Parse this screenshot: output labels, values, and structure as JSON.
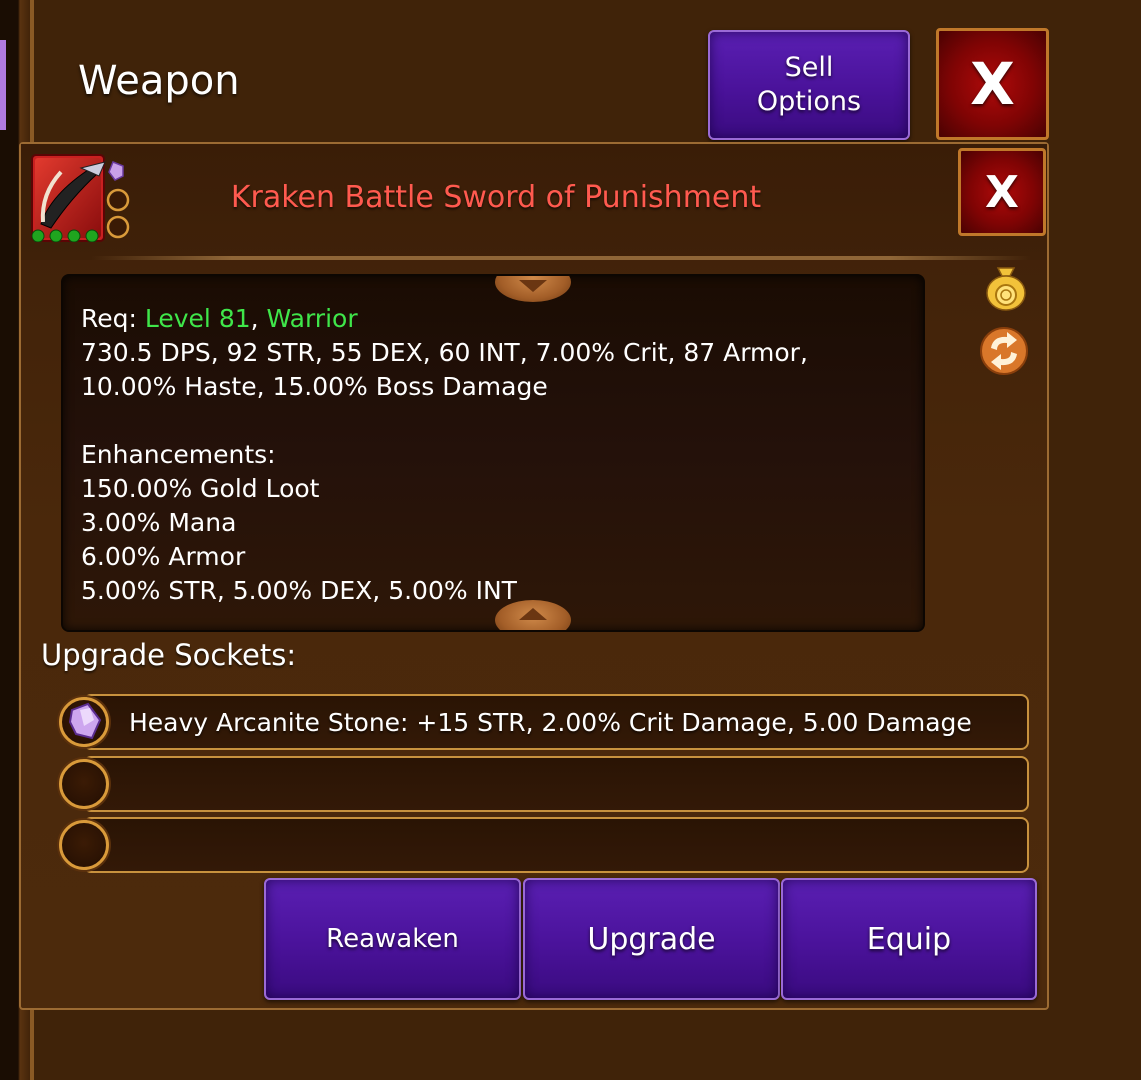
{
  "window": {
    "title": "Weapon",
    "sell_button_label": "Sell\nOptions",
    "close_label": "X"
  },
  "item": {
    "name": "Kraken Battle Sword of Punishment",
    "name_color": "#ff5a4f",
    "close_label": "X",
    "gem_slots": 3,
    "upgrade_pips": 4
  },
  "stats": {
    "req_prefix": "Req: ",
    "req_level": "Level 81",
    "req_separator": ", ",
    "req_class": "Warrior",
    "req_color": "#3fe64a",
    "line1": "730.5 DPS, 92 STR, 55 DEX, 60 INT, 7.00% Crit, 87 Armor,",
    "line2": "10.00% Haste, 15.00% Boss Damage",
    "enh_title": "Enhancements:",
    "enh1": "150.00% Gold Loot",
    "enh2": "3.00% Mana",
    "enh3": "6.00% Armor",
    "enh4": "5.00% STR, 5.00% DEX, 5.00% INT"
  },
  "side_icons": [
    "gold-bag-icon",
    "swap-icon"
  ],
  "sockets": {
    "title": "Upgrade Sockets:",
    "slots": [
      {
        "text": "Heavy Arcanite Stone: +15 STR, 2.00% Crit Damage, 5.00 Damage",
        "gem": "crystal-gem-icon"
      },
      {
        "text": ""
      },
      {
        "text": ""
      }
    ]
  },
  "actions": {
    "reawaken": "Reawaken",
    "upgrade": "Upgrade",
    "equip": "Equip"
  },
  "colors": {
    "purple_button": "#4a129a",
    "red_close": "#800404",
    "panel_brown": "#402309",
    "border_gold": "#c8923e"
  }
}
